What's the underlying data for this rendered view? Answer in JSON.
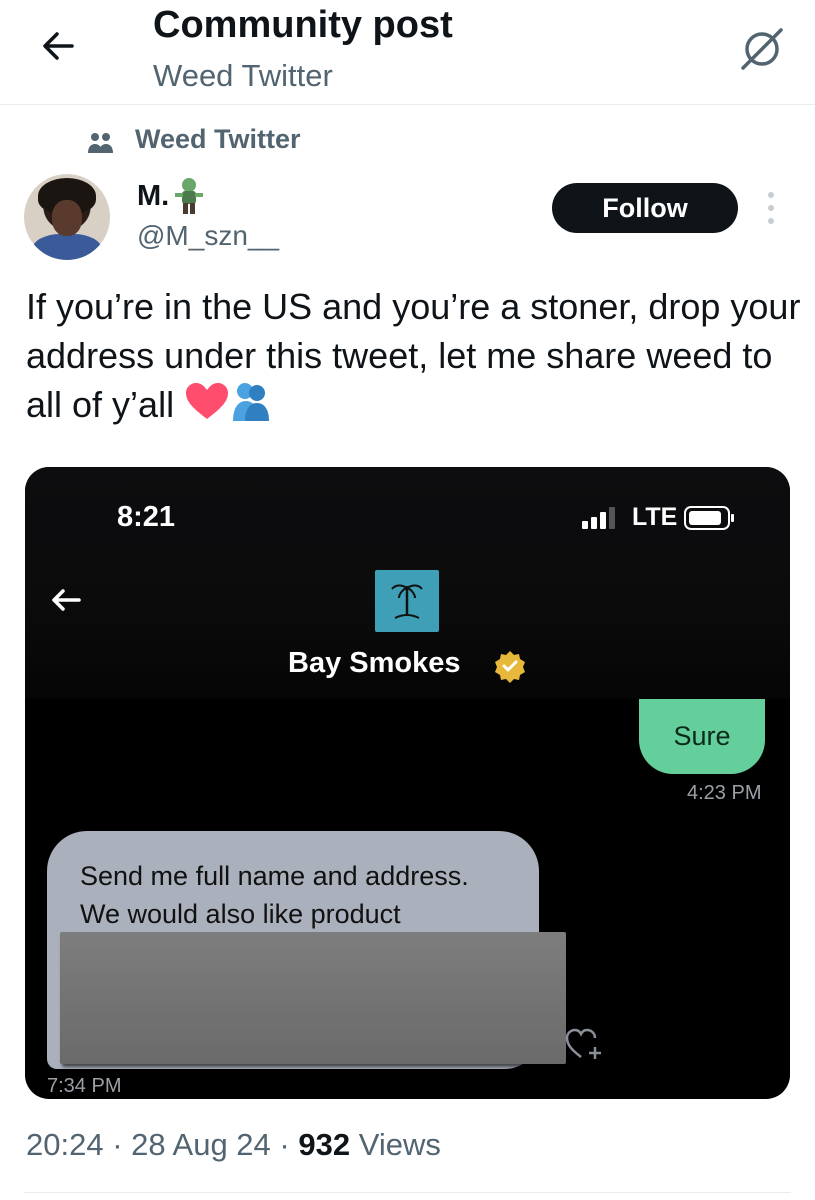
{
  "header": {
    "title": "Community post",
    "subtitle": "Weed Twitter",
    "back_icon": "arrow-left-icon",
    "hide_icon": "eye-slash-icon"
  },
  "community": {
    "label": "Weed Twitter",
    "icon": "people-icon"
  },
  "author": {
    "name": "M.",
    "name_emoji": "zombie-emoji",
    "handle": "@M_szn__",
    "follow_label": "Follow"
  },
  "tweet": {
    "text": "If you’re in the US and you’re a stoner, drop your address under this tweet, let me share weed to all of y’all",
    "emojis": [
      "heart-emoji",
      "hugging-people-emoji"
    ]
  },
  "screenshot": {
    "status_time": "8:21",
    "network": "LTE",
    "contact_name": "Bay Smokes",
    "sent_message": "Sure",
    "sent_time": "4:23 PM",
    "received_line1": "Send me full name and address.",
    "received_line2": "We would also like product",
    "received_time": "7:34 PM"
  },
  "meta": {
    "time": "20:24",
    "date": "28 Aug 24",
    "views_count": "932",
    "views_label": "Views"
  },
  "colors": {
    "text_primary": "#0f1419",
    "text_secondary": "#536471",
    "follow_bg": "#0f1419",
    "sent_bubble": "#64cf9a",
    "received_bubble": "#aab0bc",
    "contact_avatar": "#3e9fb6",
    "verified": "#e8b83a"
  }
}
